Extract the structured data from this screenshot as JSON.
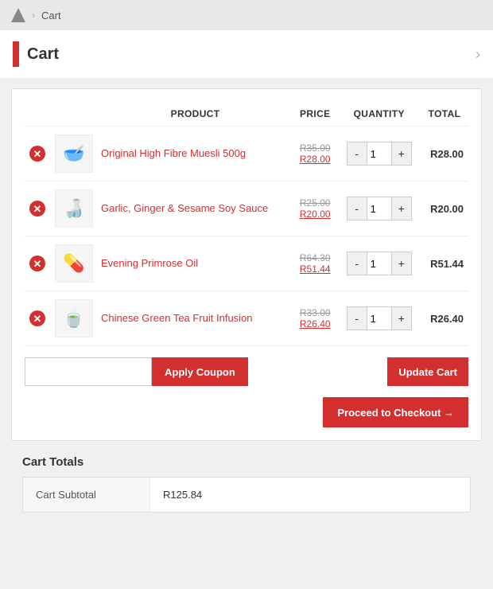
{
  "breadcrumb": {
    "home_label": "Cart",
    "cart_label": "Cart"
  },
  "page_header": {
    "title": "Cart",
    "chevron": "›"
  },
  "cart_table": {
    "columns": [
      "",
      "",
      "PRODUCT",
      "PRICE",
      "QUANTITY",
      "TOTAL"
    ],
    "rows": [
      {
        "id": 1,
        "icon": "🥣",
        "name": "Original High Fibre Muesli 500g",
        "price_original": "R35.00",
        "price_sale": "R28.00",
        "quantity": 1,
        "total": "R28.00"
      },
      {
        "id": 2,
        "icon": "🍶",
        "name": "Garlic, Ginger & Sesame Soy Sauce",
        "price_original": "R25.00",
        "price_sale": "R20.00",
        "quantity": 1,
        "total": "R20.00"
      },
      {
        "id": 3,
        "icon": "💊",
        "name": "Evening Primrose Oil",
        "price_original": "R64.30",
        "price_sale": "R51.44",
        "quantity": 1,
        "total": "R51.44"
      },
      {
        "id": 4,
        "icon": "🍵",
        "name": "Chinese Green Tea Fruit Infusion",
        "price_original": "R33.00",
        "price_sale": "R26.40",
        "quantity": 1,
        "total": "R26.40"
      }
    ]
  },
  "actions": {
    "coupon_placeholder": "",
    "apply_coupon_label": "Apply Coupon",
    "update_cart_label": "Update Cart",
    "checkout_label": "Proceed to Checkout →"
  },
  "cart_totals": {
    "title": "Cart Totals",
    "subtotal_label": "Cart Subtotal",
    "subtotal_value": "R125.84"
  }
}
